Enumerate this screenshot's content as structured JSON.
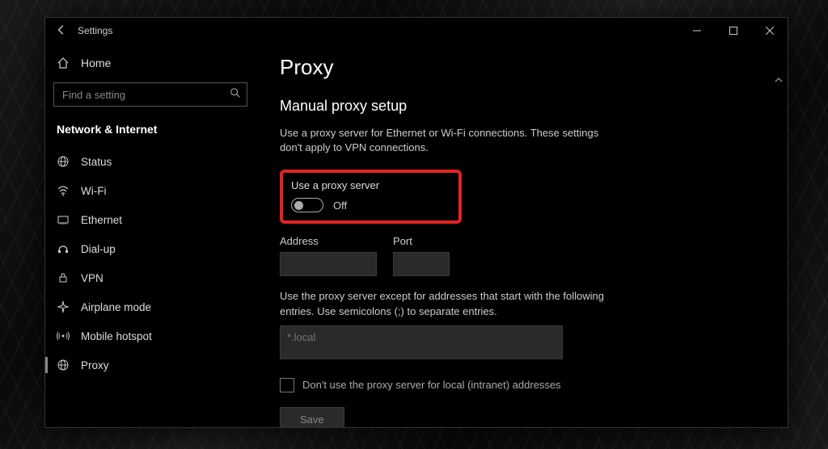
{
  "window": {
    "title": "Settings"
  },
  "sidebar": {
    "home_label": "Home",
    "search_placeholder": "Find a setting",
    "category": "Network & Internet",
    "items": [
      {
        "label": "Status",
        "icon": "status"
      },
      {
        "label": "Wi-Fi",
        "icon": "wifi"
      },
      {
        "label": "Ethernet",
        "icon": "ethernet"
      },
      {
        "label": "Dial-up",
        "icon": "dialup"
      },
      {
        "label": "VPN",
        "icon": "vpn"
      },
      {
        "label": "Airplane mode",
        "icon": "airplane"
      },
      {
        "label": "Mobile hotspot",
        "icon": "hotspot"
      },
      {
        "label": "Proxy",
        "icon": "proxy",
        "active": true
      }
    ]
  },
  "main": {
    "page_title": "Proxy",
    "section_title": "Manual proxy setup",
    "description": "Use a proxy server for Ethernet or Wi-Fi connections. These settings don't apply to VPN connections.",
    "use_proxy_label": "Use a proxy server",
    "toggle_state": "Off",
    "address_label": "Address",
    "address_value": "",
    "port_label": "Port",
    "port_value": "",
    "exceptions_desc": "Use the proxy server except for addresses that start with the following entries. Use semicolons (;) to separate entries.",
    "exceptions_placeholder": "*.local",
    "bypass_local_label": "Don't use the proxy server for local (intranet) addresses",
    "save_label": "Save"
  }
}
